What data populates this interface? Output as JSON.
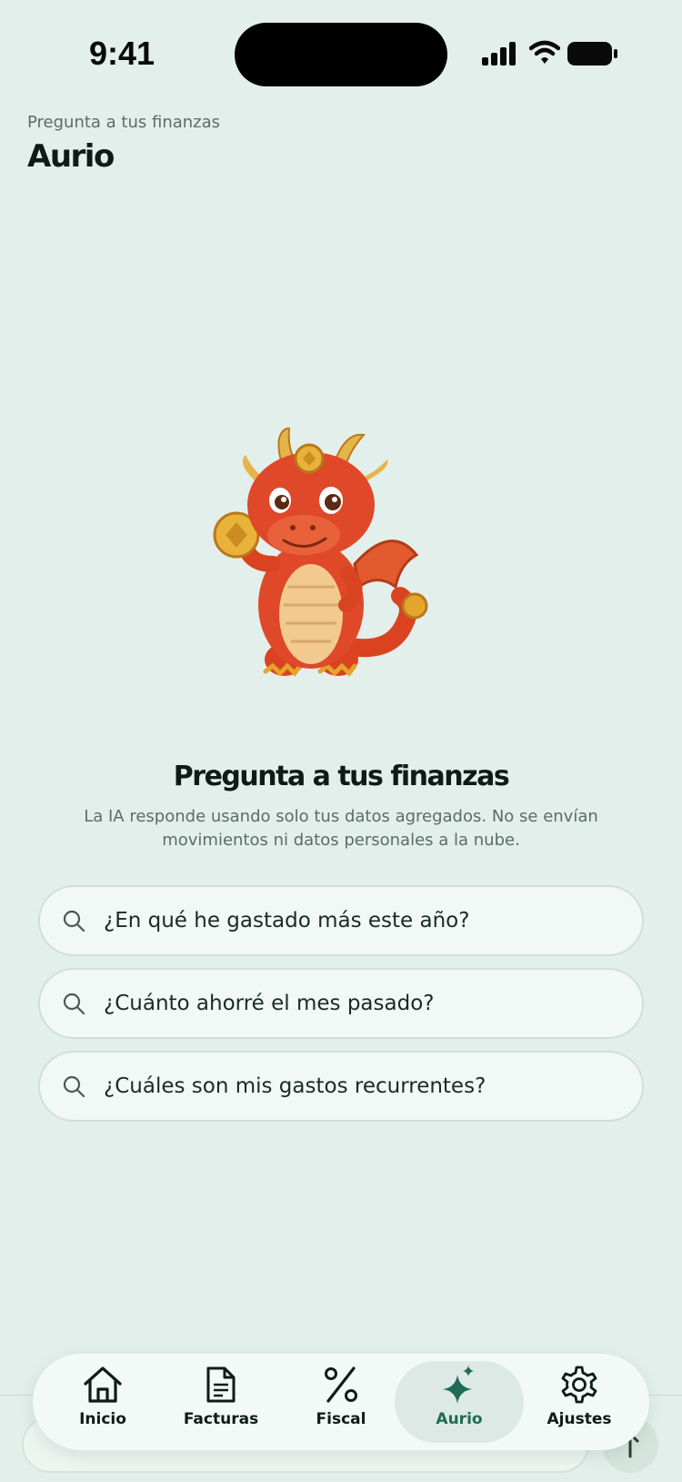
{
  "status_bar": {
    "time": "9:41"
  },
  "header": {
    "subtitle": "Pregunta a tus finanzas",
    "title": "Aurio"
  },
  "mascot": {
    "icon": "dragon-mascot"
  },
  "hero": {
    "title": "Pregunta a tus finanzas",
    "description": "La IA responde usando solo tus datos agregados. No se envían movimientos ni datos personales a la nube."
  },
  "suggestions": [
    {
      "label": "¿En qué he gastado más este año?",
      "icon": "search-icon"
    },
    {
      "label": "¿Cuánto ahorré el mes pasado?",
      "icon": "search-icon"
    },
    {
      "label": "¿Cuáles son mis gastos recurrentes?",
      "icon": "search-icon"
    }
  ],
  "tabs": [
    {
      "label": "Inicio",
      "icon": "home-icon",
      "active": false
    },
    {
      "label": "Facturas",
      "icon": "document-icon",
      "active": false
    },
    {
      "label": "Fiscal",
      "icon": "percent-icon",
      "active": false
    },
    {
      "label": "Aurio",
      "icon": "sparkle-icon",
      "active": true
    },
    {
      "label": "Ajustes",
      "icon": "gear-icon",
      "active": false
    }
  ],
  "colors": {
    "background": "#e3efea",
    "accent": "#1f6b57",
    "text": "#0f1b17",
    "muted": "#5a6e66"
  }
}
